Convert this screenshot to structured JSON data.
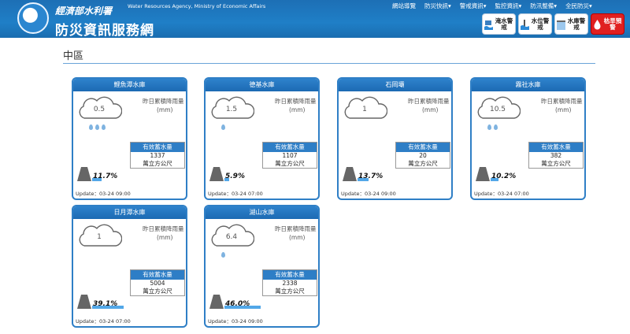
{
  "header": {
    "ministry_name": "經濟部水利署",
    "english_name": "Water Resources Agency, Ministry of Economic Affairs",
    "site_title": "防災資訊服務網",
    "nav": [
      "網站導覽",
      "防災快訊▾",
      "警戒資訊▾",
      "監控資訊▾",
      "防汛整備▾",
      "全民防災▾"
    ],
    "alerts": [
      {
        "label": "淹水警戒",
        "icon": "flood-icon"
      },
      {
        "label": "水位警戒",
        "icon": "water-level-icon"
      },
      {
        "label": "水庫警戒",
        "icon": "reservoir-icon"
      },
      {
        "label": "枯旱預警",
        "icon": "drought-icon",
        "color": "#e02020"
      }
    ]
  },
  "region": "中區",
  "labels": {
    "rain": "昨日累積降雨量",
    "rain_unit": "(mm)",
    "storage_header": "有效蓄水量",
    "storage_unit": "萬立方公尺"
  },
  "cards": [
    {
      "name": "鯉魚潭水庫",
      "rain": "0.5",
      "drops": 3,
      "storage": "1337",
      "percent_text": "11.7%",
      "percent": 11.7,
      "update": "Update：03-24 09:00"
    },
    {
      "name": "德基水庫",
      "rain": "1.5",
      "drops": 1,
      "storage": "1107",
      "percent_text": "5.9%",
      "percent": 5.9,
      "update": "Update：03-24 07:00"
    },
    {
      "name": "石岡壩",
      "rain": "1",
      "drops": 0,
      "storage": "20",
      "percent_text": "13.7%",
      "percent": 13.7,
      "update": "Update：03-24 09:00"
    },
    {
      "name": "霧社水庫",
      "rain": "10.5",
      "drops": 2,
      "storage": "382",
      "percent_text": "10.2%",
      "percent": 10.2,
      "update": "Update：03-24 07:00"
    },
    {
      "name": "日月潭水庫",
      "rain": "1",
      "drops": 0,
      "storage": "5004",
      "percent_text": "39.1%",
      "percent": 39.1,
      "update": "Update：03-24 07:00"
    },
    {
      "name": "湖山水庫",
      "rain": "6.4",
      "drops": 1,
      "storage": "2338",
      "percent_text": "46.0%",
      "percent": 46.0,
      "update": "Update：03-24 09:00"
    }
  ]
}
